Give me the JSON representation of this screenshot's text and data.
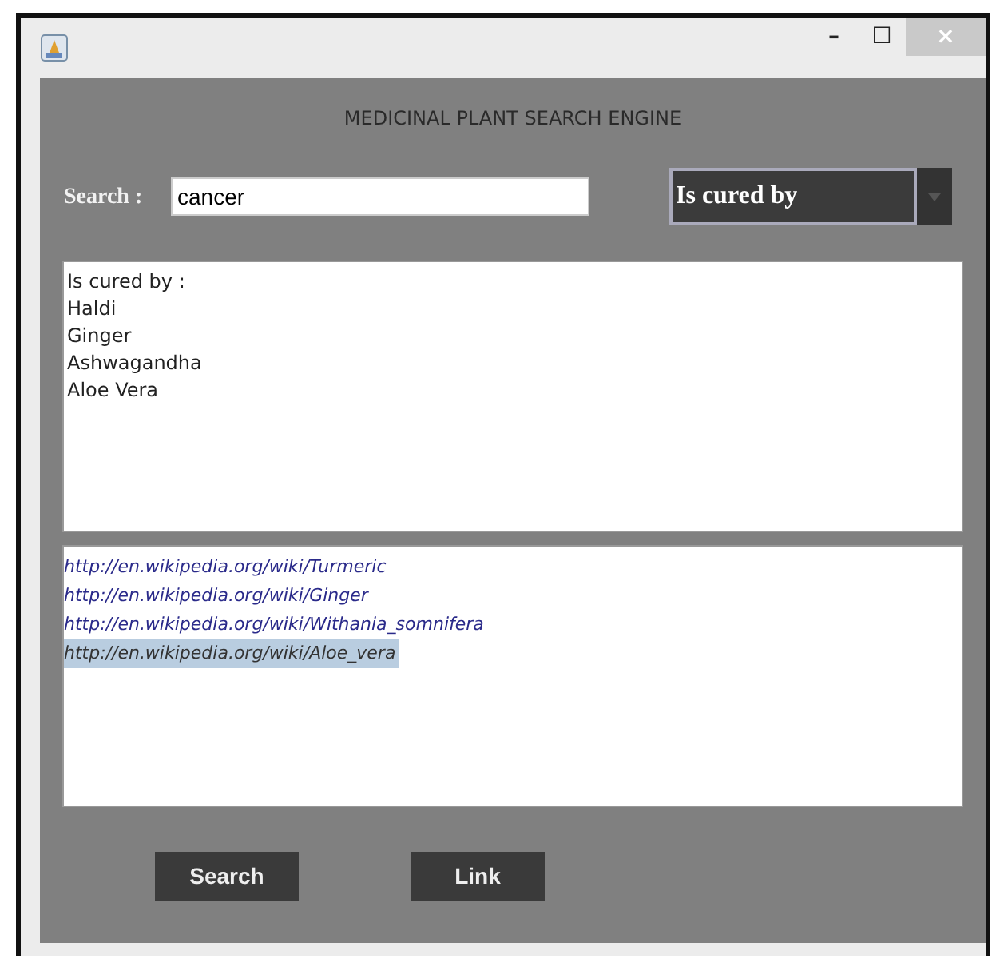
{
  "window": {
    "controls": [
      "–",
      "☐",
      "×"
    ]
  },
  "heading": "MEDICINAL PLANT SEARCH ENGINE",
  "search": {
    "label": "Search :",
    "value": "cancer"
  },
  "relation": {
    "value": "Is cured by"
  },
  "results": {
    "header": "Is cured by :",
    "items": [
      "Haldi",
      "Ginger",
      "Ashwagandha",
      "Aloe Vera"
    ]
  },
  "links": [
    {
      "url": "http://en.wikipedia.org/wiki/Turmeric",
      "selected": false
    },
    {
      "url": "http://en.wikipedia.org/wiki/Ginger",
      "selected": false
    },
    {
      "url": "http://en.wikipedia.org/wiki/Withania_somnifera",
      "selected": false
    },
    {
      "url": "http://en.wikipedia.org/wiki/Aloe_vera",
      "selected": true
    }
  ],
  "buttons": [
    "Search",
    "Link"
  ]
}
